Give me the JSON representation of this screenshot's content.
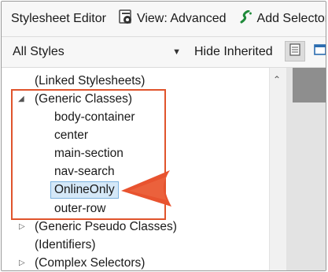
{
  "toolbar": {
    "title": "Stylesheet Editor",
    "view_label": "View: Advanced",
    "add_selector_label": "Add Selector"
  },
  "filter": {
    "dropdown_value": "All Styles",
    "hide_inherited_label": "Hide Inherited"
  },
  "tree": {
    "linked_stylesheets": "(Linked Stylesheets)",
    "generic_classes": "(Generic Classes)",
    "classes": {
      "c0": "body-container",
      "c1": "center",
      "c2": "main-section",
      "c3": "nav-search",
      "c4": "OnlineOnly",
      "c5": "outer-row"
    },
    "generic_pseudo_classes": "(Generic Pseudo Classes)",
    "identifiers": "(Identifiers)",
    "complex_selectors": "(Complex Selectors)"
  },
  "colors": {
    "highlight": "#e0542c",
    "selection_bg": "#d5e8f8",
    "selection_border": "#7db3e0",
    "callout": "#e8532f"
  }
}
